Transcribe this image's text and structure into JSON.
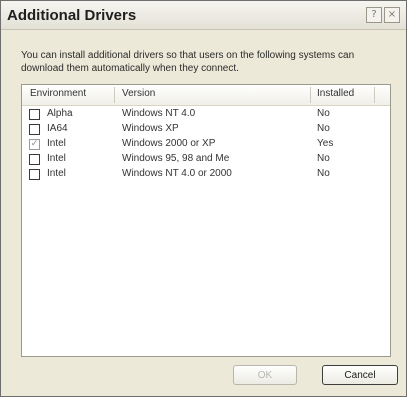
{
  "window": {
    "title": "Additional Drivers",
    "help_icon": "?",
    "close_icon": "×"
  },
  "description": "You can install additional drivers so that users on the following systems can download them automatically when they connect.",
  "table": {
    "columns": [
      "Environment",
      "Version",
      "Installed"
    ],
    "rows": [
      {
        "checked": false,
        "environment": "Alpha",
        "version": "Windows NT 4.0",
        "installed": "No"
      },
      {
        "checked": false,
        "environment": "IA64",
        "version": "Windows XP",
        "installed": "No"
      },
      {
        "checked": true,
        "environment": "Intel",
        "version": "Windows 2000 or XP",
        "installed": "Yes"
      },
      {
        "checked": false,
        "environment": "Intel",
        "version": "Windows 95, 98 and Me",
        "installed": "No"
      },
      {
        "checked": false,
        "environment": "Intel",
        "version": "Windows NT 4.0 or 2000",
        "installed": "No"
      }
    ]
  },
  "buttons": {
    "ok": "OK",
    "cancel": "Cancel"
  },
  "checkmark": "✓"
}
